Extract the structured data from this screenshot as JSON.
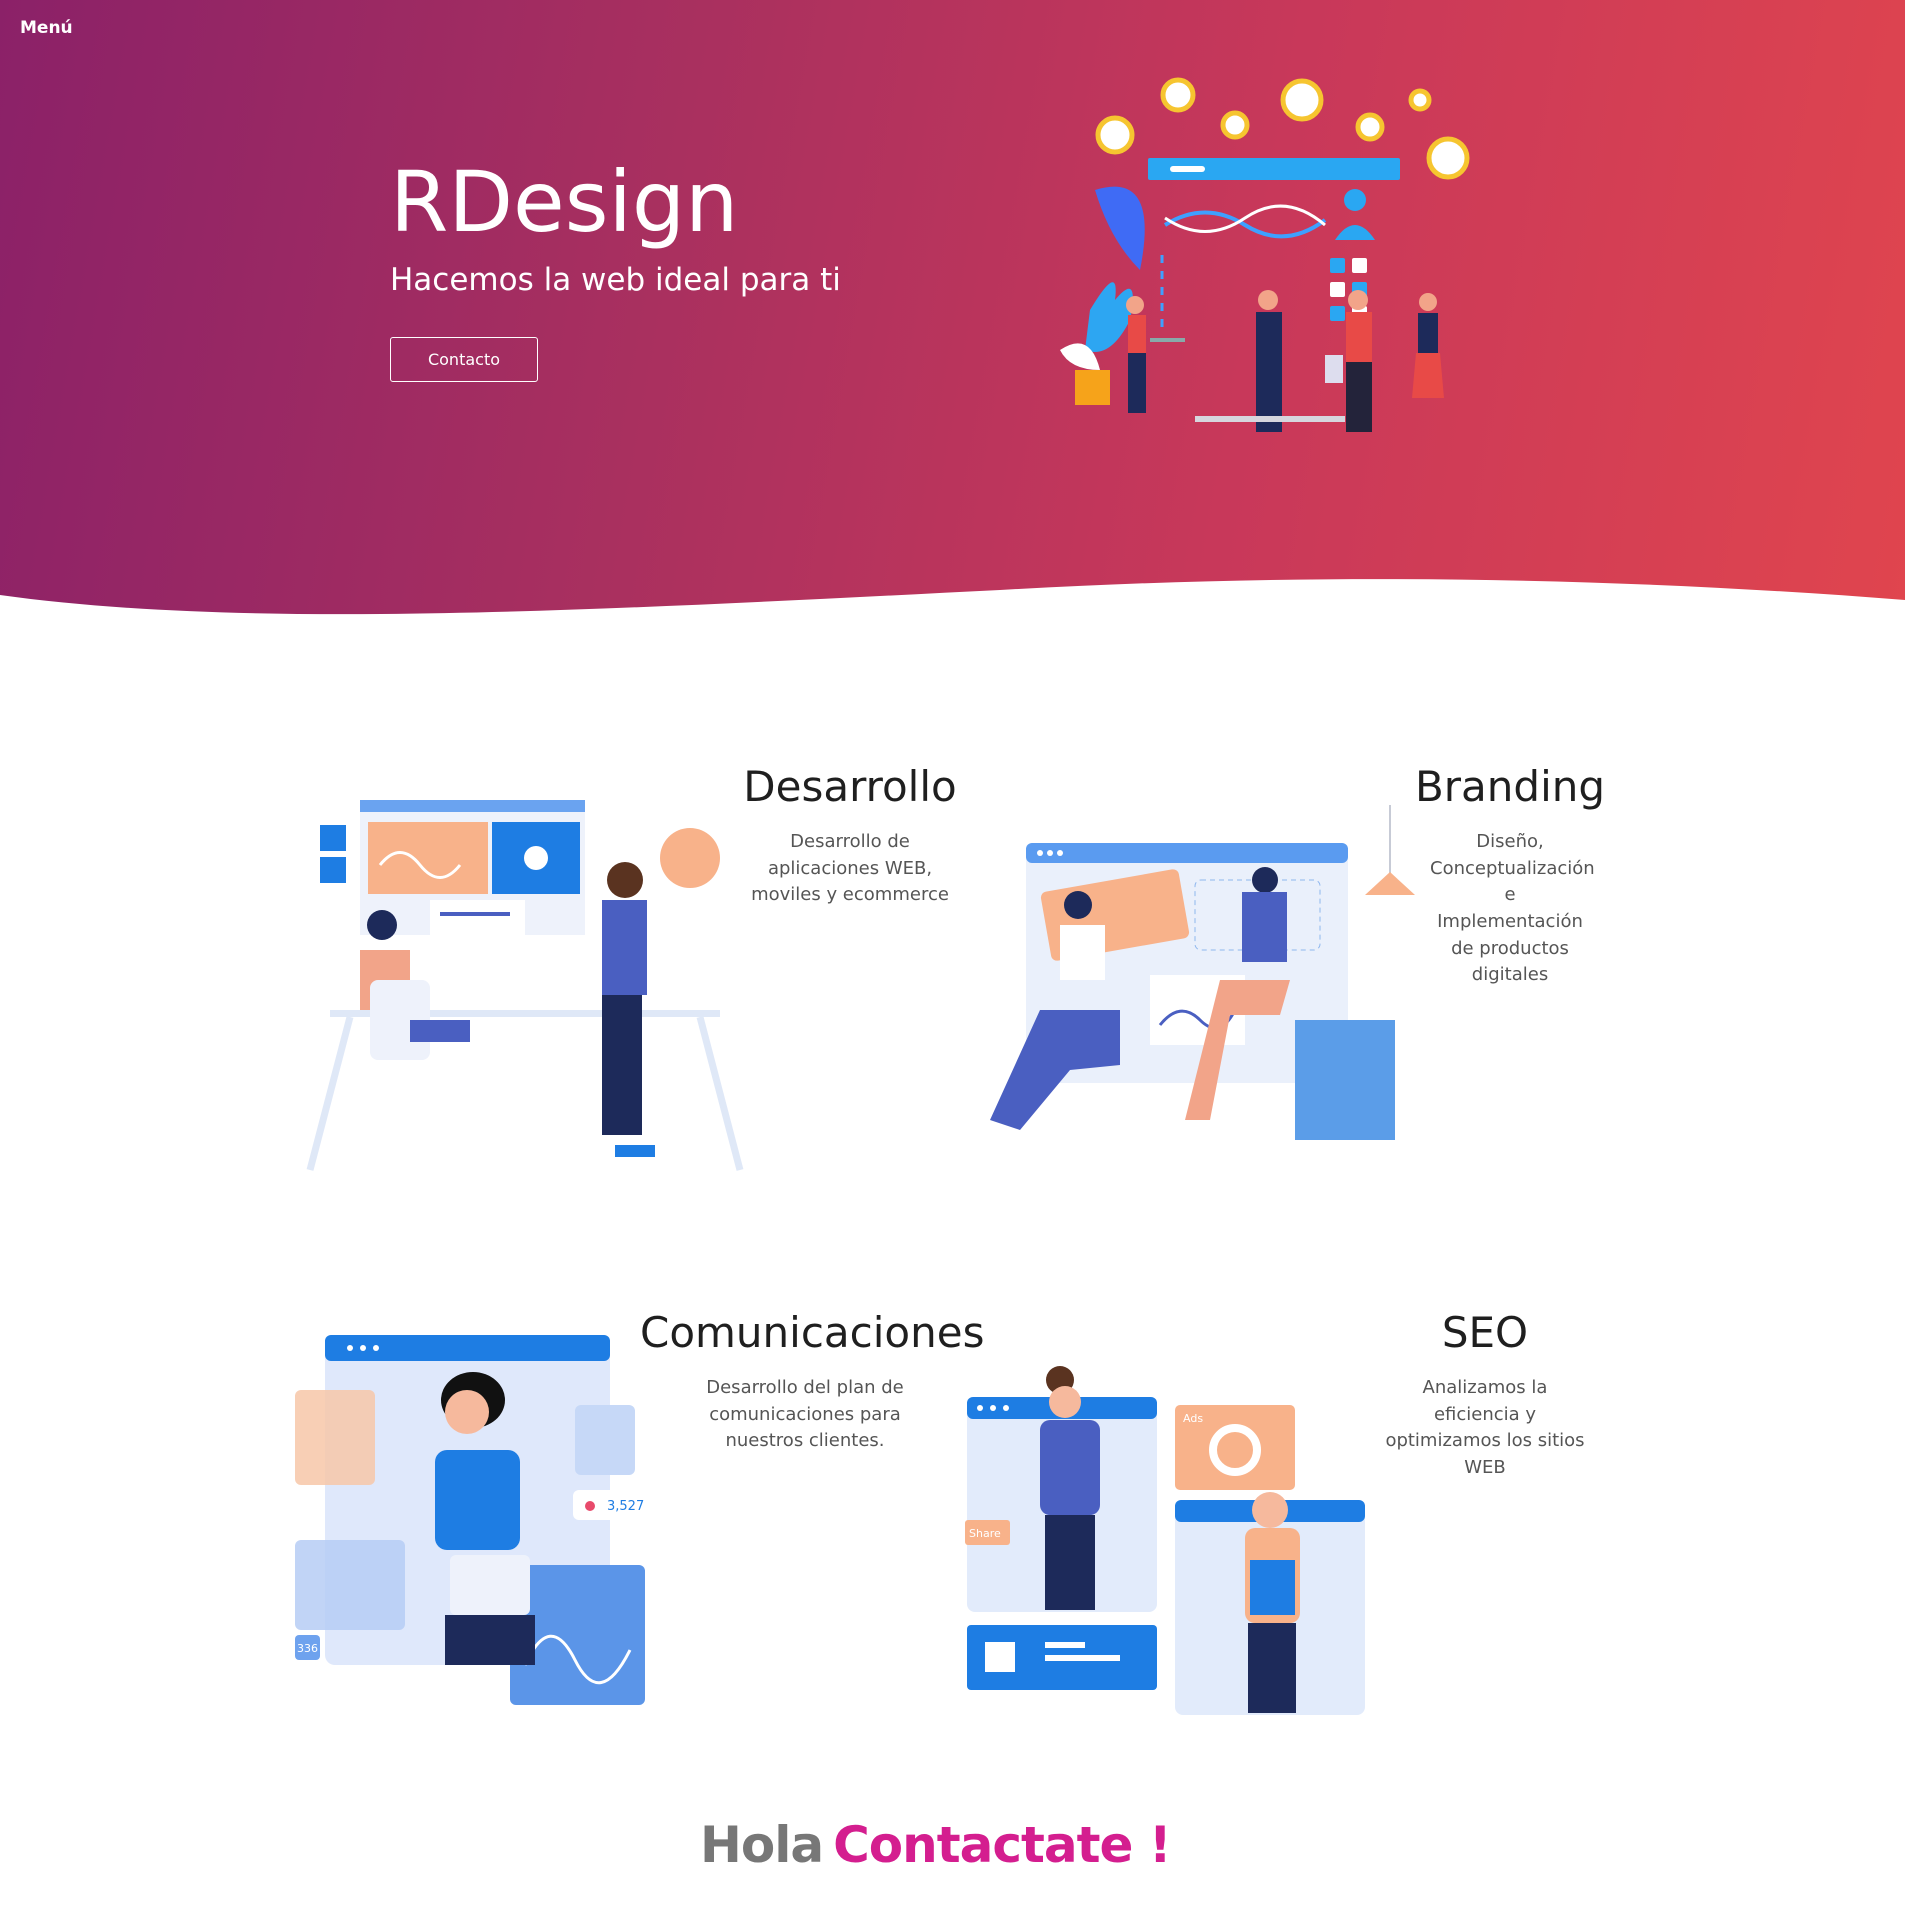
{
  "nav": {
    "menu_label": "Menú"
  },
  "hero": {
    "title": "RDesign",
    "subtitle": "Hacemos la web ideal para ti",
    "cta_label": "Contacto"
  },
  "services": [
    {
      "title": "Desarrollo",
      "description": "Desarrollo de aplicaciones WEB, moviles y ecommerce"
    },
    {
      "title": "Branding",
      "description": "Diseño, Conceptualización e Implementación de productos digitales"
    },
    {
      "title": "Comunicaciones",
      "description": "Desarrollo del plan de comunicaciones para nuestros clientes."
    },
    {
      "title": "SEO",
      "description": "Analizamos la eficiencia y optimizamos los sitios WEB"
    }
  ],
  "illustration_text": {
    "likes": "3,527",
    "ads": "Ads",
    "share": "Share",
    "counter": "336"
  },
  "contact": {
    "word1": "Hola",
    "word2": "Contactate !"
  },
  "colors": {
    "hero_start": "#8b2168",
    "hero_end": "#e0454e",
    "accent_blue": "#1e7de3",
    "accent_peach": "#f8b28a",
    "contact_pink": "#d41e8f"
  }
}
